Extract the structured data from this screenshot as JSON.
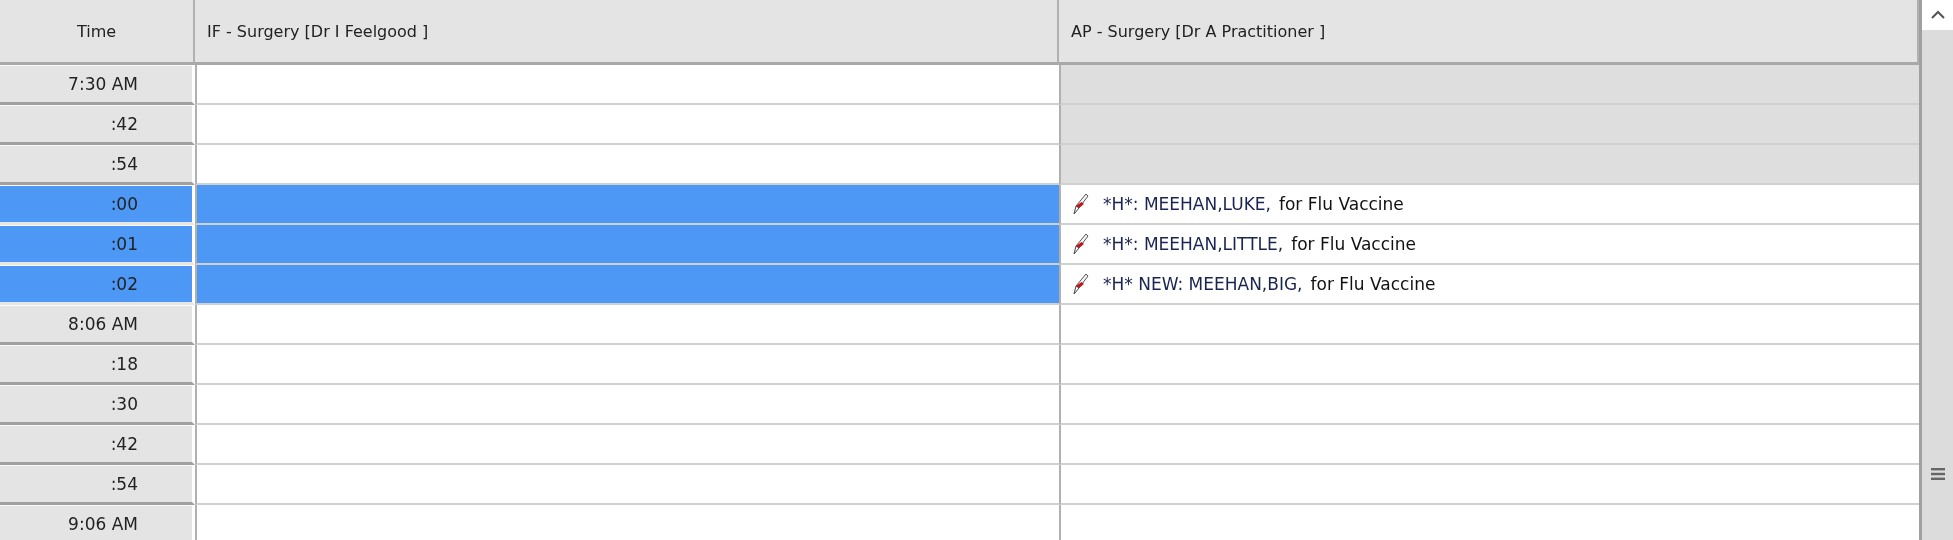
{
  "table": {
    "columns": [
      {
        "label": "Time"
      },
      {
        "label": "IF - Surgery [Dr I Feelgood ]"
      },
      {
        "label": "AP - Surgery [Dr A Practitioner ]"
      }
    ],
    "rows": [
      {
        "time": "7:30 AM",
        "selected": false,
        "ap_unavailable": true
      },
      {
        "time": ":42",
        "selected": false,
        "ap_unavailable": true
      },
      {
        "time": ":54",
        "selected": false,
        "ap_unavailable": true
      },
      {
        "time": ":00",
        "selected": true,
        "ap_unavailable": false,
        "appointment": {
          "patient": "*H*: MEEHAN,LUKE,",
          "reason": "for Flu Vaccine"
        }
      },
      {
        "time": ":01",
        "selected": true,
        "ap_unavailable": false,
        "appointment": {
          "patient": "*H*: MEEHAN,LITTLE,",
          "reason": "for Flu Vaccine"
        }
      },
      {
        "time": ":02",
        "selected": true,
        "ap_unavailable": false,
        "appointment": {
          "patient": "*H* NEW: MEEHAN,BIG,",
          "reason": "for Flu Vaccine"
        }
      },
      {
        "time": "8:06 AM",
        "selected": false,
        "ap_unavailable": false
      },
      {
        "time": ":18",
        "selected": false,
        "ap_unavailable": false
      },
      {
        "time": ":30",
        "selected": false,
        "ap_unavailable": false
      },
      {
        "time": ":42",
        "selected": false,
        "ap_unavailable": false
      },
      {
        "time": ":54",
        "selected": false,
        "ap_unavailable": false
      },
      {
        "time": "9:06 AM",
        "selected": false,
        "ap_unavailable": false
      }
    ]
  }
}
